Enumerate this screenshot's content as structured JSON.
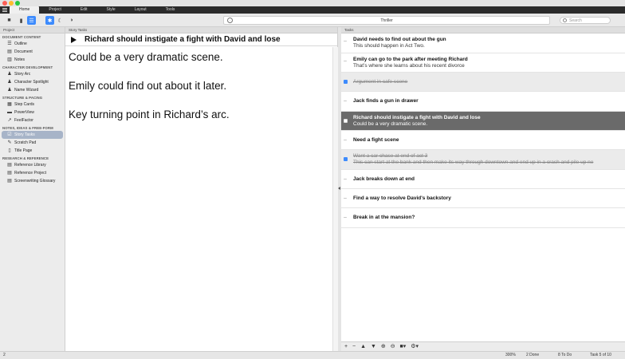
{
  "tabs": [
    "Home",
    "Project",
    "Edit",
    "Style",
    "Layout",
    "Tools"
  ],
  "toolbar": {
    "document_title": "Thriller",
    "search_placeholder": "Search"
  },
  "sidebar": {
    "header": "Project",
    "sections": [
      {
        "title": "DOCUMENT CONTENT",
        "items": [
          {
            "label": "Outline",
            "icon": "☰"
          },
          {
            "label": "Document",
            "icon": "▤"
          },
          {
            "label": "Notes",
            "icon": "▥"
          }
        ]
      },
      {
        "title": "CHARACTER DEVELOPMENT",
        "items": [
          {
            "label": "Story Arc",
            "icon": "♟"
          },
          {
            "label": "Character Spotlight",
            "icon": "♟"
          },
          {
            "label": "Name Wizard",
            "icon": "♟"
          }
        ]
      },
      {
        "title": "STRUCTURE & PACING",
        "items": [
          {
            "label": "Step Cards",
            "icon": "▦"
          },
          {
            "label": "PowerView",
            "icon": "▬"
          },
          {
            "label": "FeelFactor",
            "icon": "↗"
          }
        ]
      },
      {
        "title": "NOTES, IDEAS & FREE-FORM",
        "items": [
          {
            "label": "Story Tasks",
            "icon": "☑",
            "selected": true
          },
          {
            "label": "Scratch Pad",
            "icon": "✎"
          },
          {
            "label": "Title Page",
            "icon": "▯"
          }
        ]
      },
      {
        "title": "RESEARCH & REFERENCE",
        "items": [
          {
            "label": "Reference Library",
            "icon": "▤"
          },
          {
            "label": "Reference Project",
            "icon": "▤"
          },
          {
            "label": "Screenwriting Glossary",
            "icon": "▤"
          }
        ]
      }
    ]
  },
  "editor": {
    "header": "Story Tasks",
    "title": "Richard should instigate a fight with David and lose",
    "lines": [
      "Could be a very dramatic scene.",
      "Emily could find out about it later.",
      "Key turning point in Richard’s arc."
    ]
  },
  "tasks": {
    "header": "Tasks",
    "items": [
      {
        "title": "David needs to find out about the gun",
        "note": "This should happen in Act Two.",
        "state": "open"
      },
      {
        "title": "Emily can go to the park after meeting Richard",
        "note": "That’s where she learns about his recent divorce",
        "state": "open"
      },
      {
        "title": "Argument in cafe scene",
        "note": "",
        "state": "done"
      },
      {
        "title": "Jack finds a gun in drawer",
        "note": "",
        "state": "open"
      },
      {
        "title": "Richard should instigate a fight with David and lose",
        "note": "Could be a very dramatic scene.",
        "state": "selected"
      },
      {
        "title": "Need a fight scene",
        "note": "",
        "state": "open"
      },
      {
        "title": "Want a car chase at end of act 3",
        "note": "This can start at the bank and then make its way through downtown and end up in a crash and pile up ne",
        "state": "done"
      },
      {
        "title": "Jack breaks down at end",
        "note": "",
        "state": "open"
      },
      {
        "title": "Find a way to resolve David's backstory",
        "note": "",
        "state": "open"
      },
      {
        "title": "Break in at the mansion?",
        "note": "",
        "state": "open"
      }
    ]
  },
  "statusbar": {
    "page": "2",
    "zoom": "300%",
    "done": "2 Done",
    "todo": "8 To Do",
    "task": "Task 5 of 10"
  }
}
